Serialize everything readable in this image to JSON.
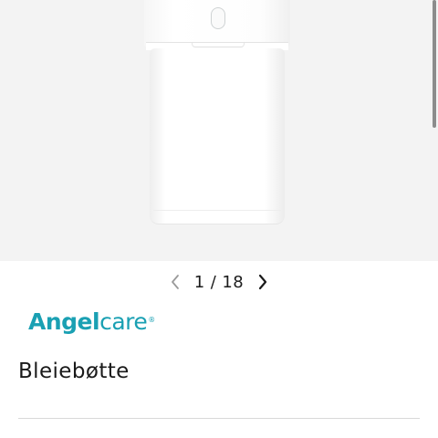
{
  "gallery": {
    "product_image": "Angelcare diaper bin product photo",
    "current_index": 1,
    "total": 18,
    "separator": "/"
  },
  "icons": {
    "prev": "chevron-left-icon",
    "next": "chevron-right-icon"
  },
  "brand": {
    "part1": "Angel",
    "part2": "care",
    "reg": "®",
    "color": "#1aa0b3"
  },
  "product": {
    "title": "Bleiebøtte"
  }
}
